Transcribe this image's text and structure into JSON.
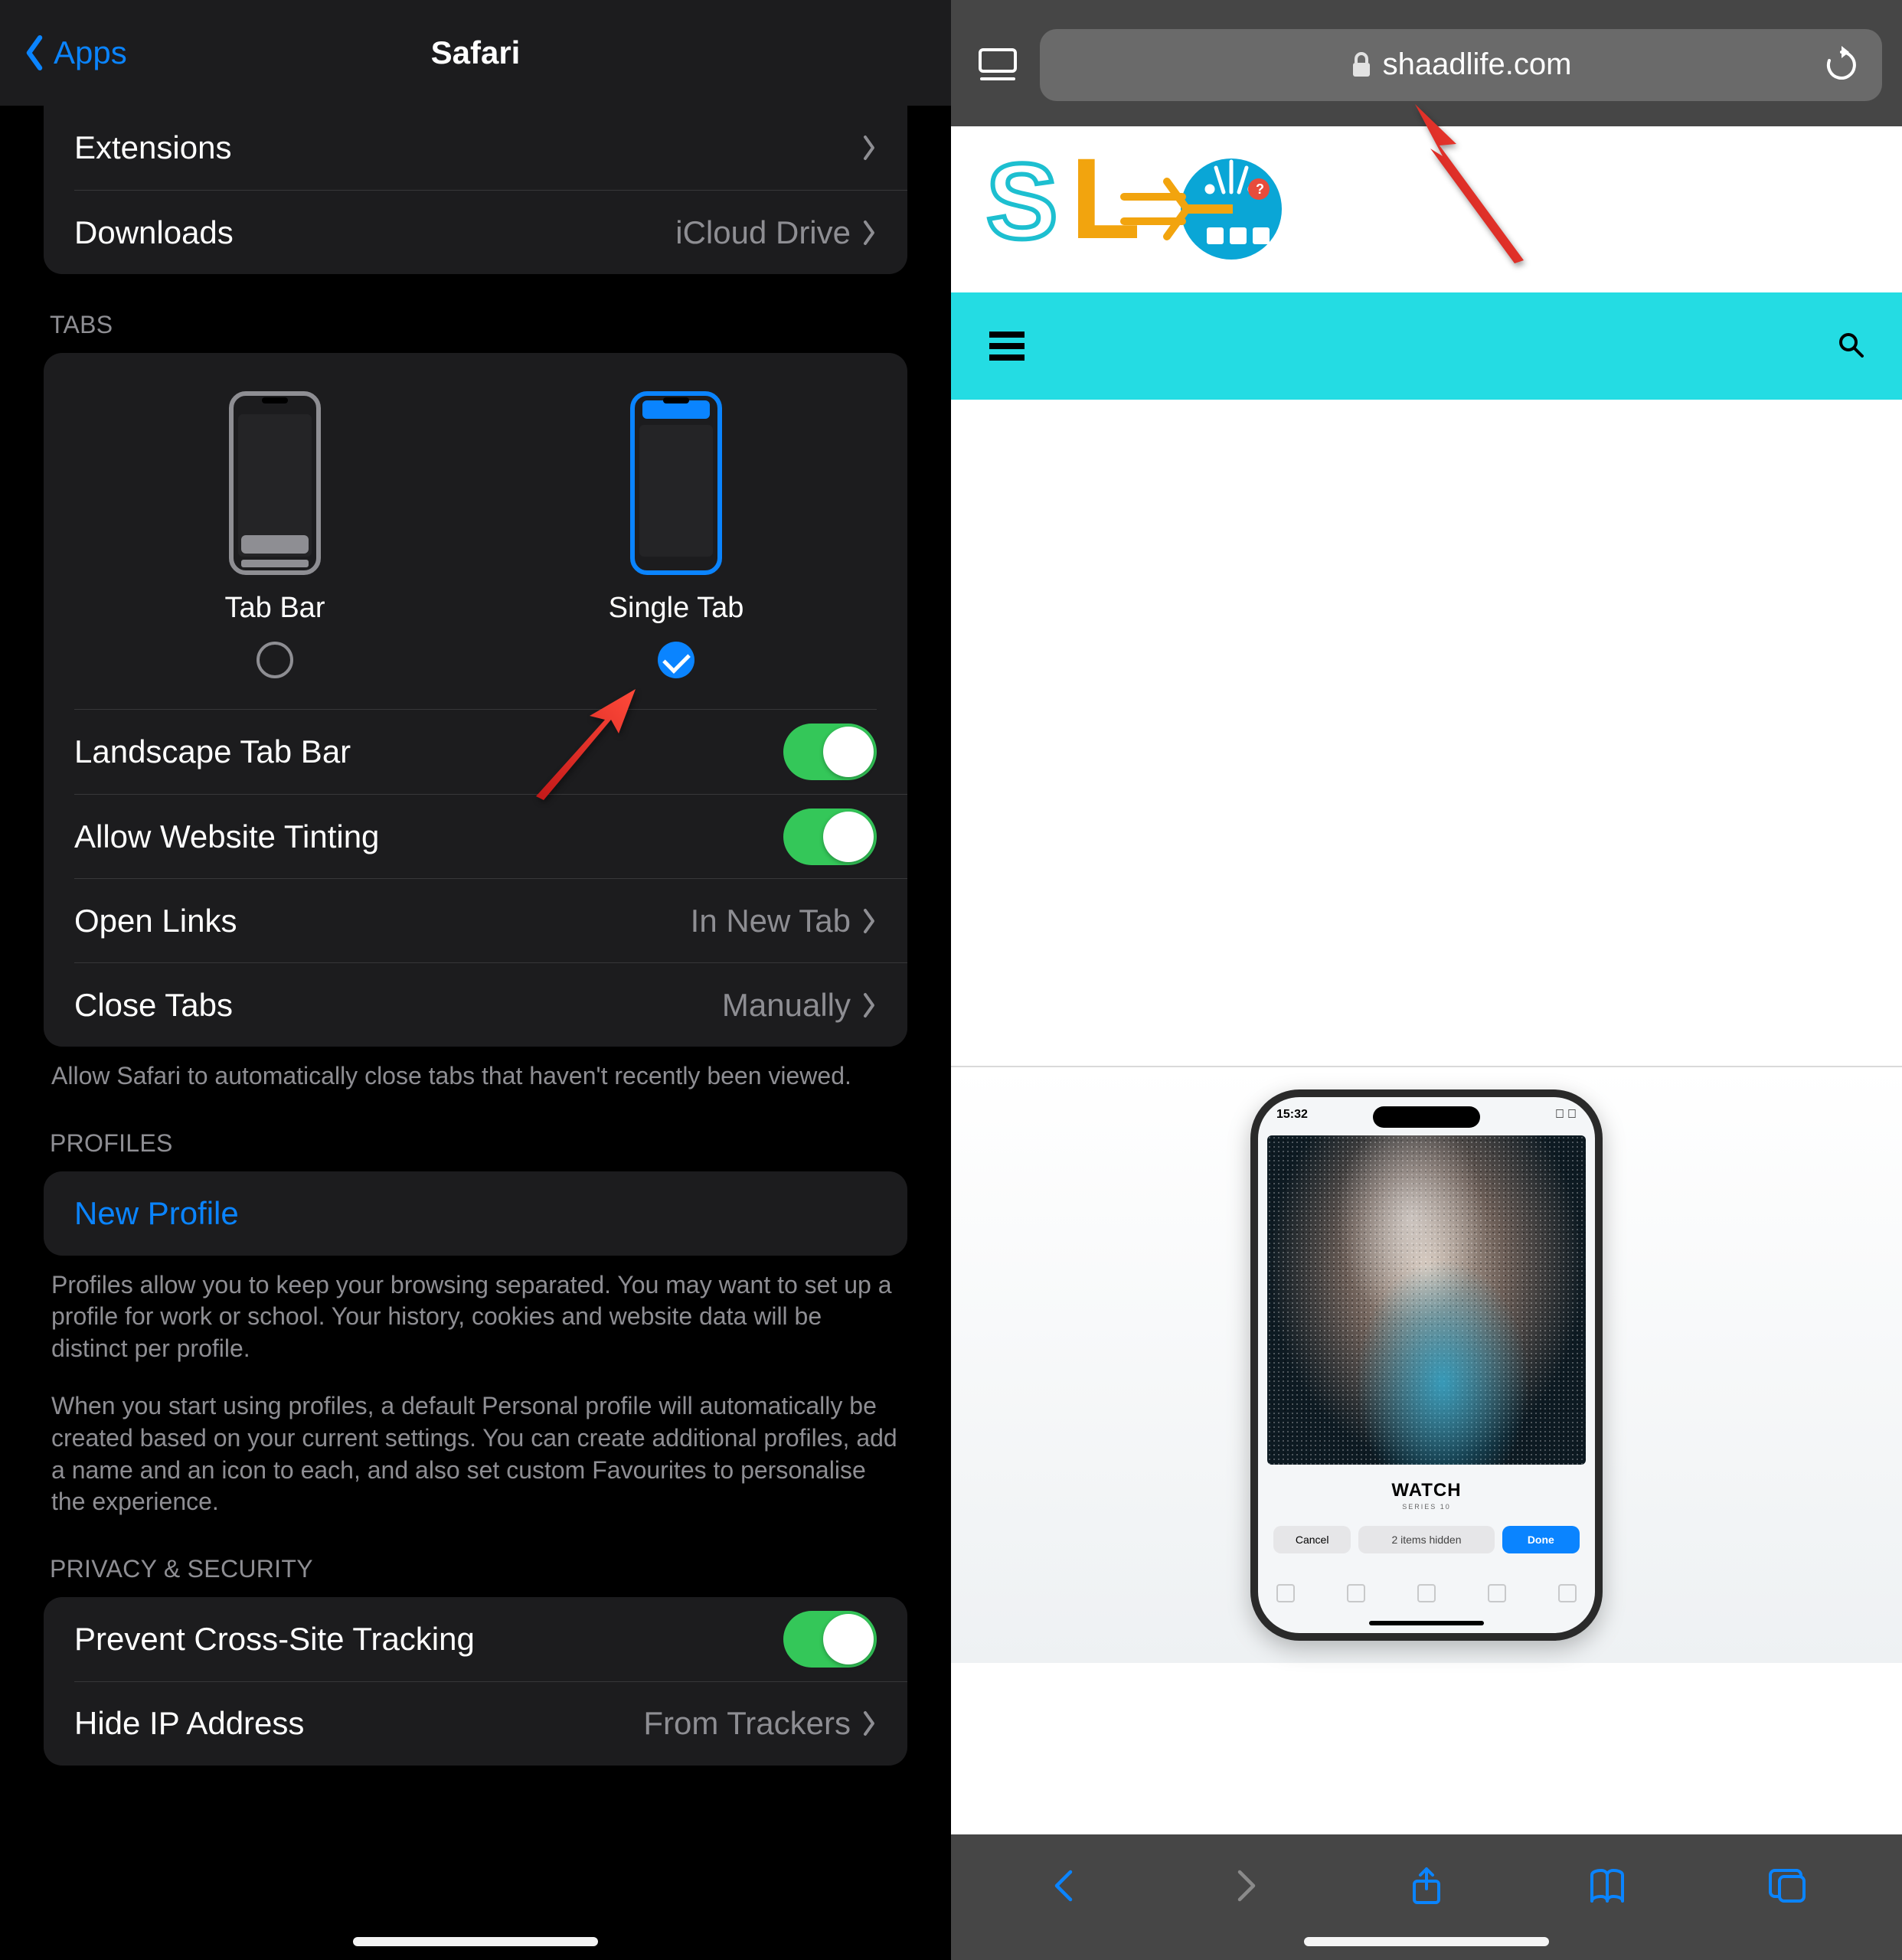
{
  "left": {
    "nav": {
      "back": "Apps",
      "title": "Safari"
    },
    "top_rows": [
      {
        "label": "Extensions",
        "value": ""
      },
      {
        "label": "Downloads",
        "value": "iCloud Drive"
      }
    ],
    "tabs_section": {
      "header": "TABS",
      "options": [
        {
          "label": "Tab Bar",
          "selected": false
        },
        {
          "label": "Single Tab",
          "selected": true
        }
      ],
      "rows": [
        {
          "label": "Landscape Tab Bar",
          "type": "toggle",
          "on": true
        },
        {
          "label": "Allow Website Tinting",
          "type": "toggle",
          "on": true
        },
        {
          "label": "Open Links",
          "type": "link",
          "value": "In New Tab"
        },
        {
          "label": "Close Tabs",
          "type": "link",
          "value": "Manually"
        }
      ],
      "footer": "Allow Safari to automatically close tabs that haven't recently been viewed."
    },
    "profiles_section": {
      "header": "PROFILES",
      "new_label": "New Profile",
      "footer1": "Profiles allow you to keep your browsing separated. You may want to set up a profile for work or school. Your history, cookies and website data will be distinct per profile.",
      "footer2": "When you start using profiles, a default Personal profile will automatically be created based on your current settings. You can create additional profiles, add a name and an icon to each, and also set custom Favourites to personalise the experience."
    },
    "privacy_section": {
      "header": "PRIVACY & SECURITY",
      "rows": [
        {
          "label": "Prevent Cross-Site Tracking",
          "type": "toggle",
          "on": true
        },
        {
          "label": "Hide IP Address",
          "type": "link",
          "value": "From Trackers"
        }
      ]
    }
  },
  "right": {
    "address": "shaadlife.com",
    "article": {
      "watch_label": "WATCH",
      "watch_sub": "SERIES 10",
      "cancel": "Cancel",
      "hidden": "2 items hidden",
      "done": "Done",
      "time": "15:32"
    }
  }
}
